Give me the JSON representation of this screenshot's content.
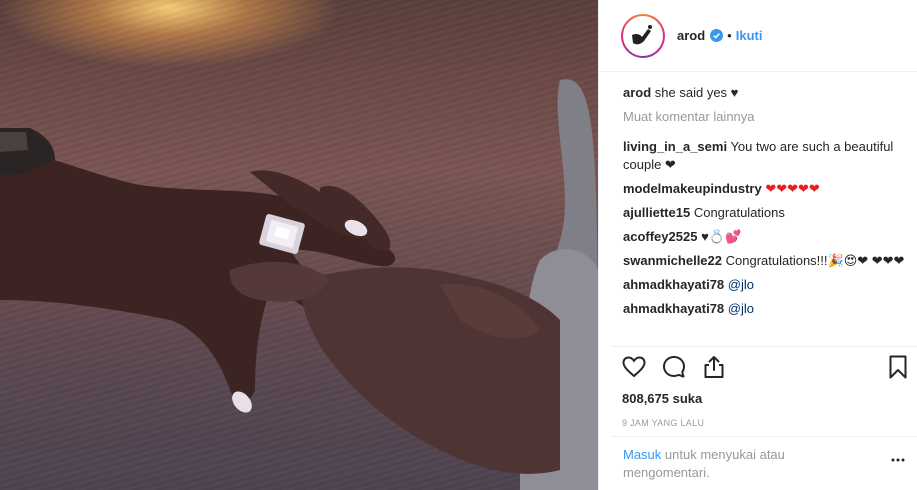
{
  "post": {
    "username": "arod",
    "follow_label": "Ikuti",
    "dot": "•",
    "caption": {
      "user": "arod",
      "text": "she said yes ♥"
    },
    "load_more": "Muat komentar lainnya",
    "comments": [
      {
        "user": "living_in_a_semi",
        "text": "You two are such a beautiful couple ❤"
      },
      {
        "user": "modelmakeupindustry",
        "text": "❤❤❤❤❤"
      },
      {
        "user": "ajulliette15",
        "text": "Congratulations"
      },
      {
        "user": "acoffey2525",
        "text": "♥💍💕"
      },
      {
        "user": "swanmichelle22",
        "text": "Congratulations!!!🎉😍❤ ❤❤❤"
      },
      {
        "user": "ahmadkhayati78",
        "text": "@jlo"
      },
      {
        "user": "ahmadkhayati78",
        "text": "@jlo"
      }
    ],
    "likes": "808,675 suka",
    "timestamp": "9 JAM YANG LALU",
    "login_link": "Masuk",
    "login_text": "untuk menyukai atau mengomentari."
  },
  "icons": {
    "verified": "verified-badge-icon",
    "like": "heart-outline-icon",
    "comment": "comment-bubble-icon",
    "share": "share-upload-icon",
    "save": "bookmark-icon",
    "more": "more-options-icon"
  },
  "colors": {
    "link": "#3897f0",
    "muted": "#999999",
    "text": "#262626",
    "heart": "#ed1c24"
  }
}
